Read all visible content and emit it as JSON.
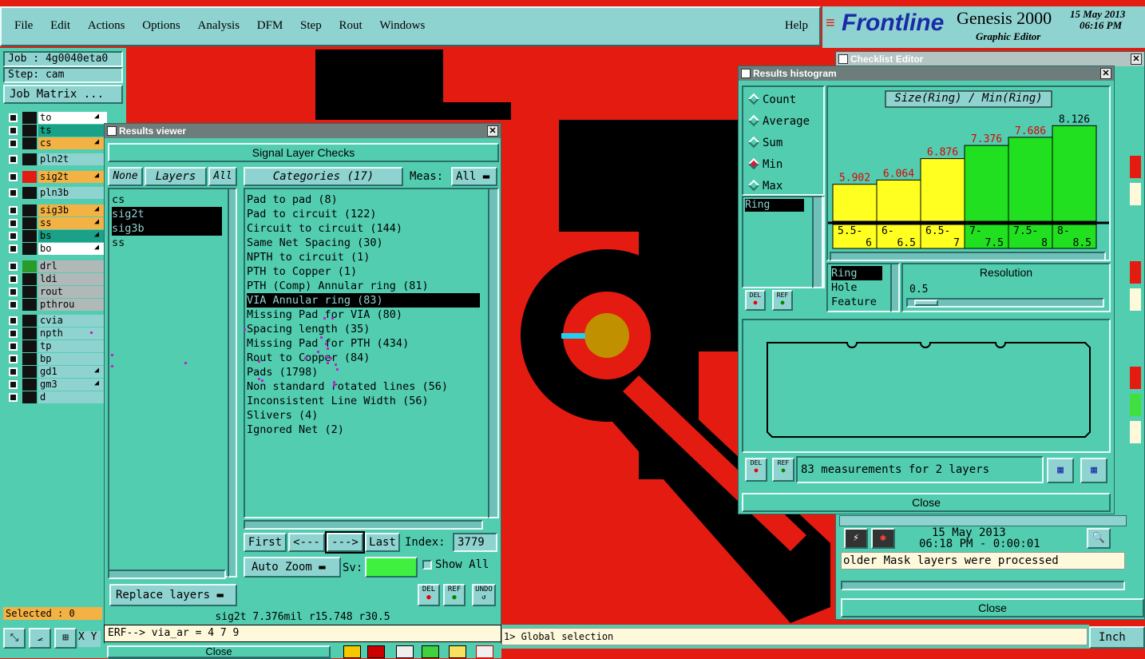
{
  "menu": {
    "items": [
      "File",
      "Edit",
      "Actions",
      "Options",
      "Analysis",
      "DFM",
      "Step",
      "Rout",
      "Windows"
    ],
    "help": "Help"
  },
  "brand": {
    "logo": "Frontline",
    "product": "Genesis 2000",
    "subtitle": "Graphic Editor",
    "date": "15 May 2013",
    "time": "06:16 PM"
  },
  "job": {
    "job": "Job : 4g0040eta0",
    "step": "Step: cam",
    "matrix_button": "Job Matrix ...",
    "selected": "Selected : 0"
  },
  "layers": [
    {
      "name": "to",
      "color": "#ffffff",
      "flag": true
    },
    {
      "name": "ts",
      "color": "#1aa187",
      "flag": false
    },
    {
      "name": "cs",
      "color": "#f5b244",
      "flag": true
    },
    {
      "name": "pln2t",
      "color": "#8fd3d0",
      "flag": false
    },
    {
      "name": "sig2t",
      "color": "#f5b244",
      "flag": true
    },
    {
      "name": "pln3b",
      "color": "#8fd3d0",
      "flag": false
    },
    {
      "name": "sig3b",
      "color": "#f5b244",
      "flag": true
    },
    {
      "name": "ss",
      "color": "#f5b244",
      "flag": true
    },
    {
      "name": "bs",
      "color": "#1aa187",
      "flag": true
    },
    {
      "name": "bo",
      "color": "#ffffff",
      "flag": true
    },
    {
      "name": "drl",
      "color": "#b0b8b8",
      "flag": false
    },
    {
      "name": "ldi",
      "color": "#b0b8b8",
      "flag": false
    },
    {
      "name": "rout",
      "color": "#b0b8b8",
      "flag": false
    },
    {
      "name": "pthrou",
      "color": "#b0b8b8",
      "flag": false
    },
    {
      "name": "cvia",
      "color": "#8fd3d0",
      "flag": false
    },
    {
      "name": "npth",
      "color": "#8fd3d0",
      "flag": false
    },
    {
      "name": "tp",
      "color": "#8fd3d0",
      "flag": false
    },
    {
      "name": "bp",
      "color": "#8fd3d0",
      "flag": false
    },
    {
      "name": "gd1",
      "color": "#8fd3d0",
      "flag": true
    },
    {
      "name": "gm3",
      "color": "#8fd3d0",
      "flag": true
    },
    {
      "name": "d",
      "color": "#8fd3d0",
      "flag": false
    }
  ],
  "results_viewer": {
    "title": "Results viewer",
    "header": "Signal Layer Checks",
    "none_btn": "None",
    "layers_btn": "Layers",
    "all_btn": "All",
    "layer_list": [
      "cs",
      "sig2t",
      "sig3b",
      "ss"
    ],
    "categories_btn": "Categories (17)",
    "meas_label": "Meas:",
    "meas_value": "All",
    "categories": [
      "Pad to pad (8)",
      "Pad to circuit (122)",
      "Circuit to circuit (144)",
      "Same Net Spacing (30)",
      "NPTH to circuit (1)",
      "PTH to Copper (1)",
      "PTH (Comp) Annular ring (81)",
      "VIA Annular ring (83)",
      "Missing Pad for VIA (80)",
      "Spacing length (35)",
      "Missing Pad for PTH (434)",
      "Rout to Copper (84)",
      "Pads (1798)",
      "Non standard rotated lines (56)",
      "Inconsistent Line Width (56)",
      "Slivers (4)",
      "Ignored Net (2)"
    ],
    "first": "First",
    "prev": "<---",
    "next": "--->",
    "last": "Last",
    "index_label": "Index:",
    "index_value": "3779",
    "zoom": "Auto Zoom",
    "sv": "Sv:",
    "show_all": "Show All",
    "replace": "Replace layers",
    "del": "DEL",
    "ref": "REF",
    "undo": "UNDO",
    "status": "sig2t 7.376mil  r15.748  r30.5",
    "close": "Close"
  },
  "command": {
    "text": "ERF--> via_ar = 4 7 9",
    "global": "1> Global selection",
    "units": "Inch",
    "xy": "X Y"
  },
  "checklist": {
    "title": "Checklist Editor",
    "date": "15 May 2013",
    "time": "06:18 PM - 0:00:01",
    "message": "older Mask layers were processed",
    "close": "Close"
  },
  "histogram": {
    "title": "Results histogram",
    "modes": [
      "Count",
      "Average",
      "Sum",
      "Min",
      "Max"
    ],
    "selected_mode": "Min",
    "attr_list": [
      "Ring"
    ],
    "chart_title": "Size(Ring) / Min(Ring)",
    "ranges": [
      "Ring",
      "Hole",
      "Feature"
    ],
    "resolution_label": "Resolution",
    "resolution_value": "0.5",
    "measurements": "83 measurements for 2 layers",
    "close": "Close",
    "del": "DEL",
    "ref": "REF"
  },
  "chart_data": {
    "type": "bar",
    "title": "Size(Ring) / Min(Ring)",
    "categories": [
      "5.5-6",
      "6-6.5",
      "6.5-7",
      "7-7.5",
      "7.5-8",
      "8-8.5"
    ],
    "values": [
      5.902,
      6.064,
      6.876,
      7.376,
      7.686,
      8.126
    ],
    "labels": [
      "5.902",
      "6.064",
      "6.876",
      "7.376",
      "7.686",
      "8.126"
    ],
    "bar_colors": [
      "#ffff20",
      "#ffff20",
      "#ffff20",
      "#20e020",
      "#20e020",
      "#20e020"
    ],
    "label_colors": [
      "#e00000",
      "#e00000",
      "#e00000",
      "#e00000",
      "#e00000",
      "#000000"
    ],
    "xlabel": "",
    "ylabel": "",
    "ylim": [
      4.5,
      8.5
    ],
    "grid": false
  }
}
